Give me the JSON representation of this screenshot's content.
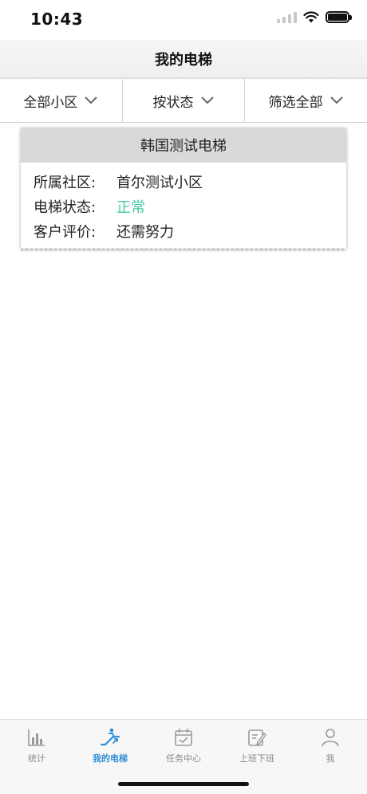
{
  "status_bar": {
    "time": "10:43"
  },
  "nav": {
    "title": "我的电梯"
  },
  "filters": [
    {
      "label": "全部小区"
    },
    {
      "label": "按状态"
    },
    {
      "label": "筛选全部"
    }
  ],
  "elevator_card": {
    "title": "韩国测试电梯",
    "rows": [
      {
        "label": "所属社区:",
        "value": "首尔测试小区"
      },
      {
        "label": "电梯状态:",
        "value": "正常"
      },
      {
        "label": "客户评价:",
        "value": "还需努力"
      }
    ],
    "status_color": "#46c8a3"
  },
  "tabs": [
    {
      "label": "统计",
      "icon": "bar-chart-icon"
    },
    {
      "label": "我的电梯",
      "icon": "escalator-icon",
      "active": true
    },
    {
      "label": "任务中心",
      "icon": "calendar-check-icon"
    },
    {
      "label": "上班下班",
      "icon": "clipboard-edit-icon"
    },
    {
      "label": "我",
      "icon": "person-icon"
    }
  ],
  "colors": {
    "accent": "#2f8fd6",
    "inactive": "#8a8a8a"
  }
}
